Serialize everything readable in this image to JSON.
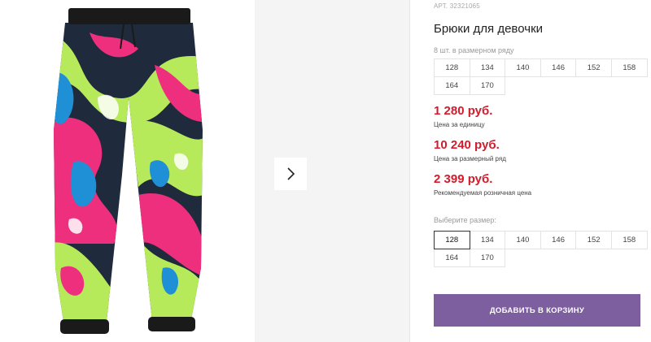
{
  "product": {
    "article": "АРТ. 32321065",
    "title": "Брюки для девочки"
  },
  "row_info": {
    "label": "8 шт. в размерном ряду",
    "sizes": [
      "128",
      "134",
      "140",
      "146",
      "152",
      "158",
      "164",
      "170"
    ]
  },
  "prices": {
    "unit_price": "1 280 руб.",
    "unit_caption": "Цена за единицу",
    "row_price": "10 240 руб.",
    "row_caption": "Цена за размерный ряд",
    "retail_price": "2 399 руб.",
    "retail_caption": "Рекомендуемая розничная цена"
  },
  "size_picker": {
    "label": "Выберите размер:",
    "sizes": [
      "128",
      "134",
      "140",
      "146",
      "152",
      "158",
      "164",
      "170"
    ],
    "selected": "128"
  },
  "cart_button": {
    "label": "ДОБАВИТЬ В КОРЗИНУ"
  },
  "icons": {
    "next": "chevron-right-icon"
  },
  "colors": {
    "price": "#d31b2c",
    "button": "#7d5e9f"
  }
}
